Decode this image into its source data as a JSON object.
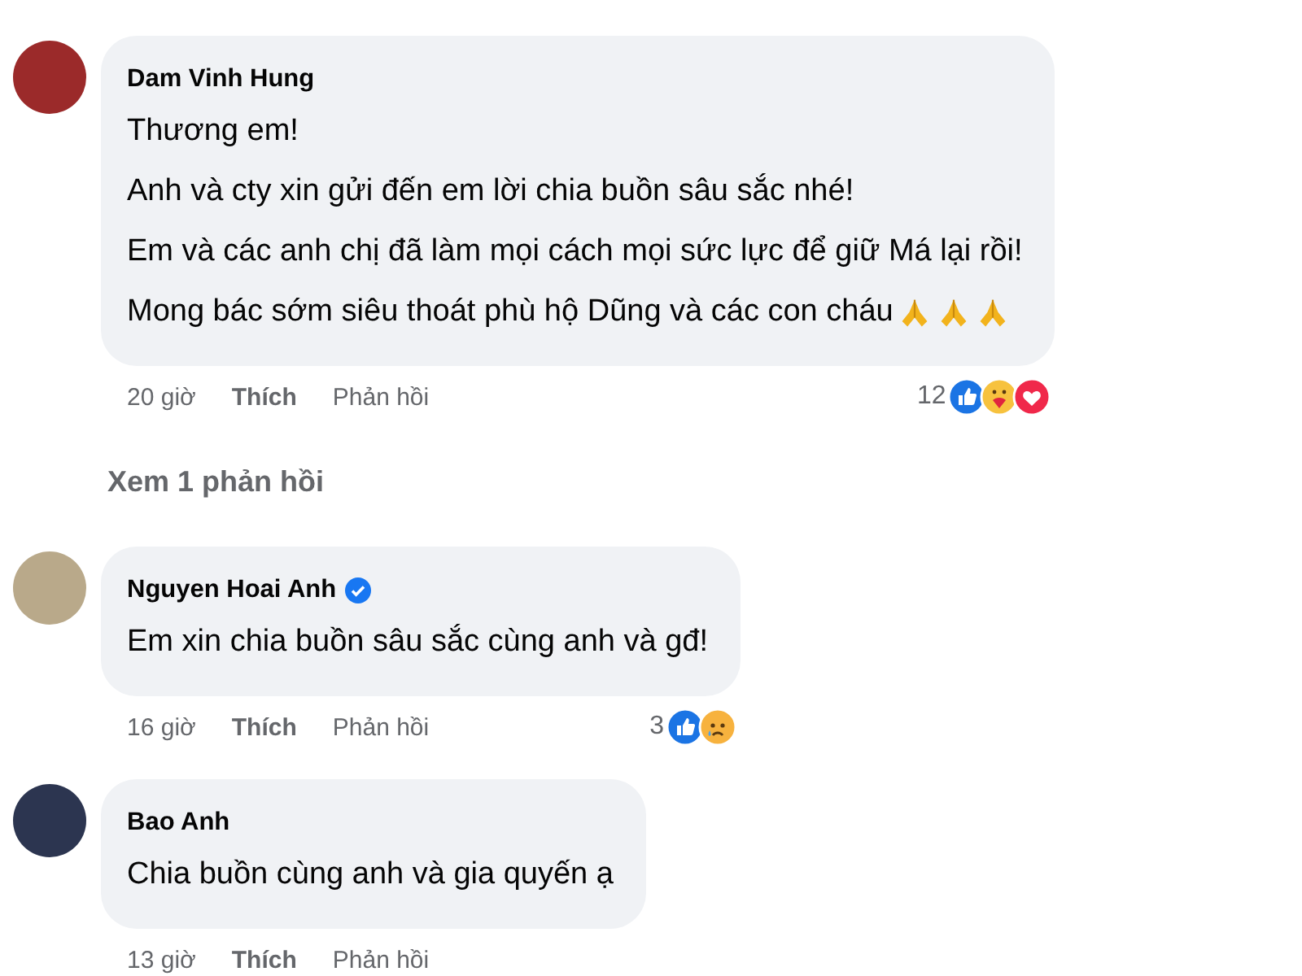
{
  "comments": [
    {
      "author": "Dam Vinh Hung",
      "verified": false,
      "lines": [
        "Thương em!",
        "Anh và cty xin gửi đến em lời chia buồn sâu sắc nhé!",
        "Em và các anh chị đã làm mọi cách mọi sức lực để giữ Má lại rồi!",
        "Mong bác sớm siêu thoát phù hộ Dũng và các con cháu"
      ],
      "line_icons": [
        {
          "kind": "pray"
        },
        {
          "kind": "pray"
        },
        {
          "kind": "pray"
        }
      ],
      "time": "20 giờ",
      "like": "Thích",
      "reply": "Phản hồi",
      "reaction_count": "12",
      "reactions": [
        {
          "kind": "like"
        },
        {
          "kind": "care"
        },
        {
          "kind": "love"
        }
      ],
      "view_replies": "Xem 1 phản hồi"
    },
    {
      "author": "Nguyen Hoai Anh",
      "verified": true,
      "lines": [
        "Em xin chia buồn sâu sắc cùng anh và gđ!"
      ],
      "time": "16 giờ",
      "like": "Thích",
      "reply": "Phản hồi",
      "reaction_count": "3",
      "reactions": [
        {
          "kind": "like"
        },
        {
          "kind": "sad"
        }
      ]
    },
    {
      "author": "Bao Anh",
      "verified": false,
      "lines": [
        "Chia buồn cùng anh và gia quyến ạ"
      ],
      "time": "13 giờ",
      "like": "Thích",
      "reply": "Phản hồi"
    }
  ]
}
